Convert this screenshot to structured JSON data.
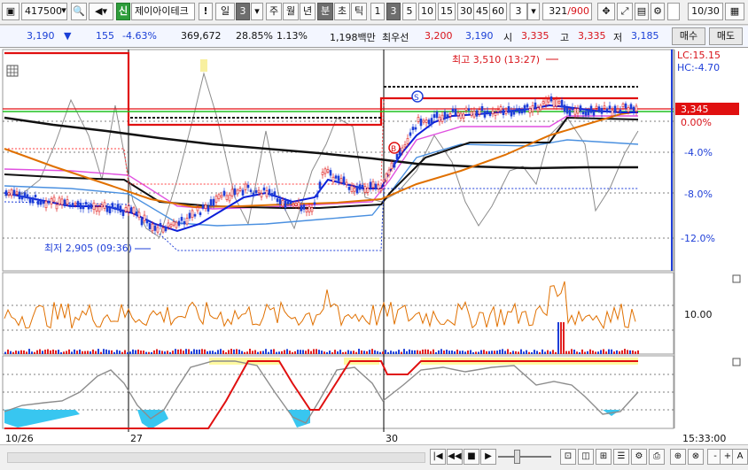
{
  "toolbar": {
    "code": "417500",
    "market_badge": "신",
    "stock_name": "제이아이테크",
    "alert": "!",
    "period_label": "일",
    "period_count": "3",
    "periods": [
      "주",
      "월",
      "년",
      "분",
      "초",
      "틱"
    ],
    "intervals": [
      "1",
      "3",
      "5",
      "10",
      "15",
      "30",
      "45",
      "60"
    ],
    "interval_value": "3",
    "bar_count": "321",
    "bar_total": "/900",
    "checkbox_checked": false,
    "date": "10/30"
  },
  "quote": {
    "price": "3,190",
    "change_arrow": "▼",
    "change": "155",
    "change_pct": "-4.63%",
    "volume": "369,672",
    "turnover_ratio": "28.85%",
    "ratio2": "1.13%",
    "amount": "1,198백만",
    "best_bid_label": "최우선",
    "bid1": "3,200",
    "bid2": "3,190",
    "open_label": "시",
    "open": "3,335",
    "high_label": "고",
    "high": "3,335",
    "low_label": "저",
    "low": "3,185",
    "buy_label": "매수",
    "sell_label": "매도"
  },
  "chart": {
    "high_annotation": "최고 3,510 (13:27)",
    "low_annotation": "최저 2,905 (09:36)",
    "lc": "LC:15.15",
    "hc": "HC:-4.70",
    "current_price": "3,345",
    "pct_labels": [
      "0.00%",
      "-4.0%",
      "-8.0%",
      "-12.0%"
    ],
    "signal_s": "S",
    "signal_b": "B",
    "volume_level": "10.00",
    "x_labels": [
      "10/26",
      "27",
      "30"
    ],
    "time": "15:33:00",
    "colors": {
      "up": "#e02020",
      "down": "#1f3fd8",
      "ma_short": "#0b1ed8",
      "ma_long": "#e07000",
      "envelope": "#e050e0",
      "signal": "#20c020"
    }
  },
  "statusbar": {
    "buttons": [
      "|◀",
      "◀◀",
      "■",
      "▶"
    ],
    "zoom_buttons": [
      "-",
      "+",
      "A"
    ]
  }
}
